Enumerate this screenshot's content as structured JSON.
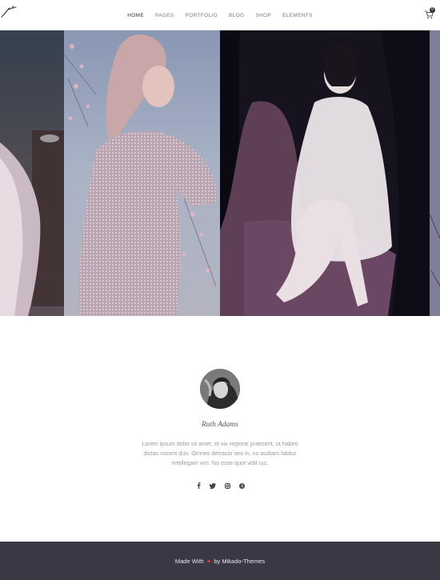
{
  "header": {
    "nav": [
      {
        "label": "HOME",
        "active": true
      },
      {
        "label": "PAGES",
        "active": false
      },
      {
        "label": "PORTFOLIO",
        "active": false
      },
      {
        "label": "BLOG",
        "active": false
      },
      {
        "label": "SHOP",
        "active": false
      },
      {
        "label": "ELEMENTS",
        "active": false
      }
    ],
    "cart_count": "0",
    "icons": {
      "logo": "logo-mark",
      "cart": "cart-icon"
    }
  },
  "bio": {
    "name": "Ruth Adams",
    "text": "Lorem ipsum dolor sit amet, et vix regione praesent, ut habeo dictas vocent duo. Omnes detracto sea in, no audiam labitur intellegam vim. No esse quot vidit ius.",
    "social_icons": [
      "facebook-icon",
      "twitter-icon",
      "instagram-icon",
      "pinterest-icon"
    ]
  },
  "footer": {
    "prefix": "Made With",
    "suffix": "by Mikado-Themes"
  },
  "colors": {
    "footer_bg": "#3a3845",
    "heart": "#e23b4a",
    "text_muted": "#9a9a9a"
  }
}
